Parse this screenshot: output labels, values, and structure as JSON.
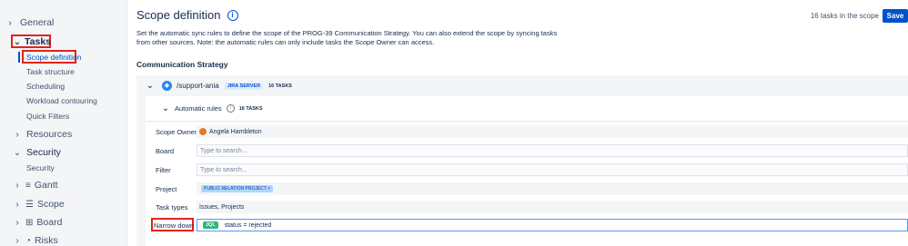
{
  "sidebar": {
    "general": "General",
    "tasks": "Tasks",
    "tasks_items": [
      "Scope definition",
      "Task structure",
      "Scheduling",
      "Workload contouring",
      "Quick Filters"
    ],
    "resources": "Resources",
    "security": "Security",
    "security_items": [
      "Security"
    ],
    "gantt": "Gantt",
    "scope": "Scope",
    "board": "Board",
    "risks": "Risks"
  },
  "header": {
    "title": "Scope definition",
    "tasks_in_scope": "16 tasks in the scope",
    "save_label": "Save"
  },
  "description": "Set the automatic sync rules to define the scope of the PROG-39 Communication Strategy. You can also extend the scope by syncing tasks from other sources. Note: the automatic rules can only include tasks the Scope Owner can access.",
  "section_title": "Communication Strategy",
  "source": {
    "path": "/support-ania",
    "server_tag": "JIRA SERVER",
    "count": "16 TASKS"
  },
  "rules": {
    "label": "Automatic rules",
    "count": "16 TASKS"
  },
  "form": {
    "scope_owner_label": "Scope Owner",
    "scope_owner_value": "Angela Hambleton",
    "board_label": "Board",
    "board_placeholder": "Type to search...",
    "filter_label": "Filter",
    "filter_placeholder": "Type to search...",
    "project_label": "Project",
    "project_tag": "PUBLIC RELATION PROJECT ×",
    "task_types_label": "Task types",
    "task_types_value": "Issues, Projects",
    "narrow_label": "Narrow down",
    "narrow_tag": "JQL",
    "narrow_value": "status = rejected"
  },
  "colors": {
    "accent": "#0052cc",
    "highlight_box": "#e2231a",
    "jql_tag": "#36b37e"
  }
}
